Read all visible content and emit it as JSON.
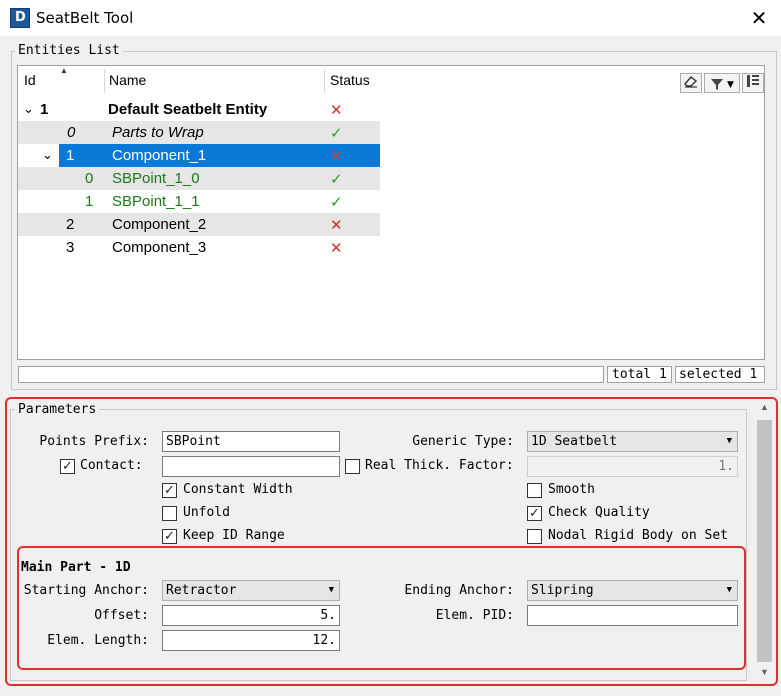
{
  "window": {
    "title": "SeatBelt Tool",
    "icon": "app-icon",
    "icon_letter": "D",
    "close_glyph": "✕"
  },
  "entities": {
    "group_title": "Entities List",
    "columns": {
      "id": "Id",
      "name": "Name",
      "status": "Status"
    },
    "toolbar": {
      "eraser": "eraser-icon",
      "filter": "filter-icon",
      "dropdown": "▼",
      "columns": "columns-icon"
    },
    "rows": [
      {
        "toggle": "⌄",
        "id": "1",
        "name": "Default Seatbelt Entity",
        "status": "✕"
      },
      {
        "id": "0",
        "name": "Parts to Wrap",
        "status": "✓"
      },
      {
        "toggle": "⌄",
        "id": "1",
        "name": "Component_1",
        "status": "✕"
      },
      {
        "id": "0",
        "name": "SBPoint_1_0",
        "status": "✓"
      },
      {
        "id": "1",
        "name": "SBPoint_1_1",
        "status": "✓"
      },
      {
        "id": "2",
        "name": "Component_2",
        "status": "✕"
      },
      {
        "id": "3",
        "name": "Component_3",
        "status": "✕"
      }
    ],
    "status": {
      "total": "total 1",
      "selected": "selected 1"
    }
  },
  "parameters": {
    "group_title": "Parameters",
    "points_prefix": {
      "label": "Points Prefix:",
      "value": "SBPoint"
    },
    "generic_type": {
      "label": "Generic Type:",
      "value": "1D Seatbelt"
    },
    "contact": {
      "label": "Contact:",
      "checked": true,
      "value": ""
    },
    "real_thick": {
      "label": "Real Thick. Factor:",
      "checked": false,
      "value": "1."
    },
    "constant_width": {
      "label": "Constant Width",
      "checked": true
    },
    "unfold": {
      "label": "Unfold",
      "checked": false
    },
    "keep_id_range": {
      "label": "Keep ID Range",
      "checked": true
    },
    "smooth": {
      "label": "Smooth",
      "checked": false
    },
    "check_quality": {
      "label": "Check Quality",
      "checked": true
    },
    "nodal_rigid": {
      "label": "Nodal Rigid Body on Set",
      "checked": false
    },
    "check_glyph": "✓"
  },
  "main_part": {
    "title": "Main Part - 1D",
    "starting_anchor": {
      "label": "Starting Anchor:",
      "value": "Retractor"
    },
    "ending_anchor": {
      "label": "Ending Anchor:",
      "value": "Slipring"
    },
    "offset": {
      "label": "Offset:",
      "value": "5."
    },
    "elem_pid": {
      "label": "Elem. PID:",
      "value": ""
    },
    "elem_length": {
      "label": "Elem. Length:",
      "value": "12."
    }
  },
  "scroll": {
    "up": "▲",
    "down": "▼"
  },
  "colors": {
    "selection": "#0a78d7",
    "highlight_box": "#e0302c",
    "check": "#2e9a2e",
    "error": "#d32f2f",
    "child_text": "#1a7a1a"
  }
}
